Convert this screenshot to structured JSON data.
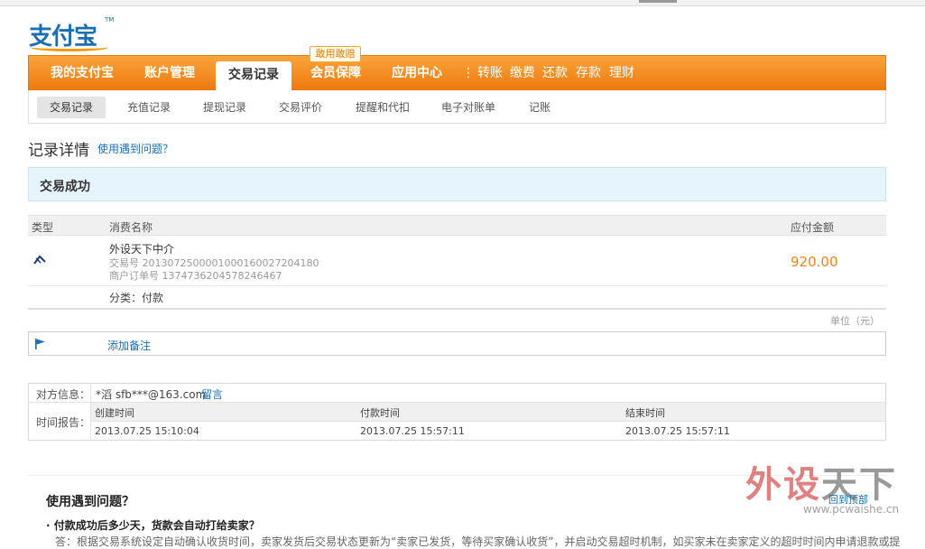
{
  "logo": {
    "text": "支付宝",
    "tm": "TM"
  },
  "nav": {
    "items": [
      "我的支付宝",
      "账户管理",
      "交易记录",
      "会员保障",
      "应用中心"
    ],
    "active": "交易记录",
    "quick_links": [
      "转账",
      "缴费",
      "还款",
      "存款",
      "理财"
    ],
    "separator": "⋮",
    "promo_badge": "敢用敢赔"
  },
  "subnav": {
    "items": [
      "交易记录",
      "充值记录",
      "提现记录",
      "交易评价",
      "提醒和代扣",
      "电子对账单",
      "记账"
    ],
    "active": "交易记录"
  },
  "page": {
    "title": "记录详情",
    "help_link": "使用遇到问题？",
    "status": "交易成功"
  },
  "table": {
    "headers": {
      "type": "类型",
      "name": "消费名称",
      "amount": "应付金额"
    },
    "row": {
      "name": "外设天下中介",
      "trade_no": "交易号 2013072500001000160027204180",
      "order_no": "商户订单号 1374736204578246467",
      "amount": "920.00",
      "category": "分类：付款"
    },
    "unit": "单位（元）"
  },
  "note": {
    "link": "添加备注"
  },
  "counterparty": {
    "label": "对方信息：",
    "value": "*滔 sfb***@163.com",
    "message_link": "留言"
  },
  "time_report": {
    "label": "时间报告：",
    "headers": [
      "创建时间",
      "付款时间",
      "结束时间"
    ],
    "values": [
      "2013.07.25 15:10:04",
      "2013.07.25 15:57:11",
      "2013.07.25 15:57:11"
    ]
  },
  "help": {
    "title": "使用遇到问题？",
    "back_to_top": "回到顶部",
    "question": "· 付款成功后多少天，货款会自动打给卖家？",
    "answer": "答：根据交易系统设定自动确认收货时间，卖家发货后交易状态更新为“卖家已发货，等待买家确认收货”，并启动交易超时机制，如买家未在卖家定义的超时时间内申请退款或提"
  },
  "watermark": {
    "big_red": "外设",
    "big_dark": "天下",
    "url": "www.pcwaishe.cn"
  },
  "colors": {
    "brand_blue": "#1a6fb4",
    "nav_orange": "#f39800",
    "amount_orange": "#f08419",
    "status_bg": "#e6f4fd"
  }
}
